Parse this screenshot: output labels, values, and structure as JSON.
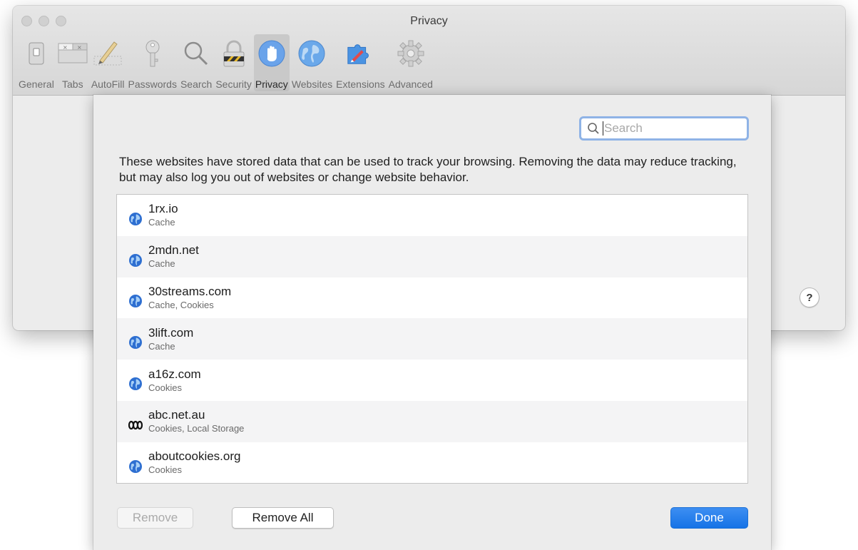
{
  "window": {
    "title": "Privacy"
  },
  "toolbar": {
    "tabs": [
      {
        "label": "General",
        "icon": "general-switch-icon"
      },
      {
        "label": "Tabs",
        "icon": "tabs-icon"
      },
      {
        "label": "AutoFill",
        "icon": "pencil-icon"
      },
      {
        "label": "Passwords",
        "icon": "key-icon"
      },
      {
        "label": "Search",
        "icon": "magnifier-icon"
      },
      {
        "label": "Security",
        "icon": "padlock-icon"
      },
      {
        "label": "Privacy",
        "icon": "hand-icon",
        "selected": true
      },
      {
        "label": "Websites",
        "icon": "globe-icon"
      },
      {
        "label": "Extensions",
        "icon": "puzzle-icon"
      },
      {
        "label": "Advanced",
        "icon": "gear-icon"
      }
    ]
  },
  "help": {
    "label": "?"
  },
  "sheet": {
    "search": {
      "placeholder": "Search",
      "value": ""
    },
    "description": "These websites have stored data that can be used to track your browsing. Removing the data may reduce tracking, but may also log you out of websites or change website behavior.",
    "sites": [
      {
        "domain": "1rx.io",
        "types": "Cache",
        "icon": "globe-icon"
      },
      {
        "domain": "2mdn.net",
        "types": "Cache",
        "icon": "globe-icon"
      },
      {
        "domain": "30streams.com",
        "types": "Cache, Cookies",
        "icon": "globe-icon"
      },
      {
        "domain": "3lift.com",
        "types": "Cache",
        "icon": "globe-icon"
      },
      {
        "domain": "a16z.com",
        "types": "Cookies",
        "icon": "globe-icon"
      },
      {
        "domain": "abc.net.au",
        "types": "Cookies, Local Storage",
        "icon": "abc-logo-icon"
      },
      {
        "domain": "aboutcookies.org",
        "types": "Cookies",
        "icon": "globe-icon"
      }
    ],
    "buttons": {
      "remove": "Remove",
      "remove_all": "Remove All",
      "done": "Done"
    }
  },
  "colors": {
    "accent": "#1673e6",
    "selected_tab": "#c9c9c9",
    "alt_row": "#f4f4f5"
  }
}
